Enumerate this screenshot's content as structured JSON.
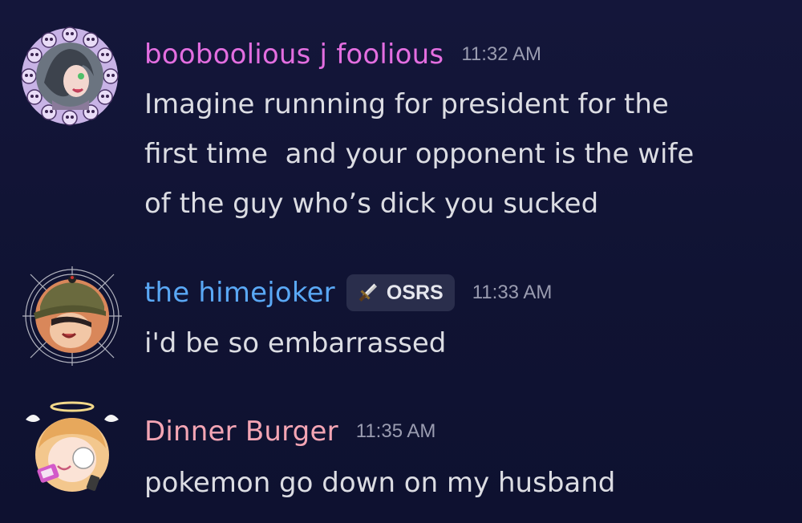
{
  "messages": [
    {
      "username": "booboolious j foolious",
      "username_color": "#e36ee0",
      "timestamp": "11:32 AM",
      "avatar_icon": "skull-ring-avatar",
      "lines": [
        "Imagine runnning for president for the",
        "first time  and your opponent is the wife",
        "of the guy who’s dick you sucked"
      ]
    },
    {
      "username": "the himejoker",
      "username_color": "#5aa8f5",
      "tag": "OSRS",
      "tag_icon": "sword-icon",
      "timestamp": "11:33 AM",
      "avatar_icon": "spiderweb-avatar",
      "lines": [
        "i'd be so embarrassed"
      ]
    },
    {
      "username": "Dinner Burger",
      "username_color": "#f4a5b4",
      "timestamp": "11:35 AM",
      "avatar_icon": "angel-avatar",
      "lines": [
        "pokemon go down on my husband"
      ]
    }
  ]
}
